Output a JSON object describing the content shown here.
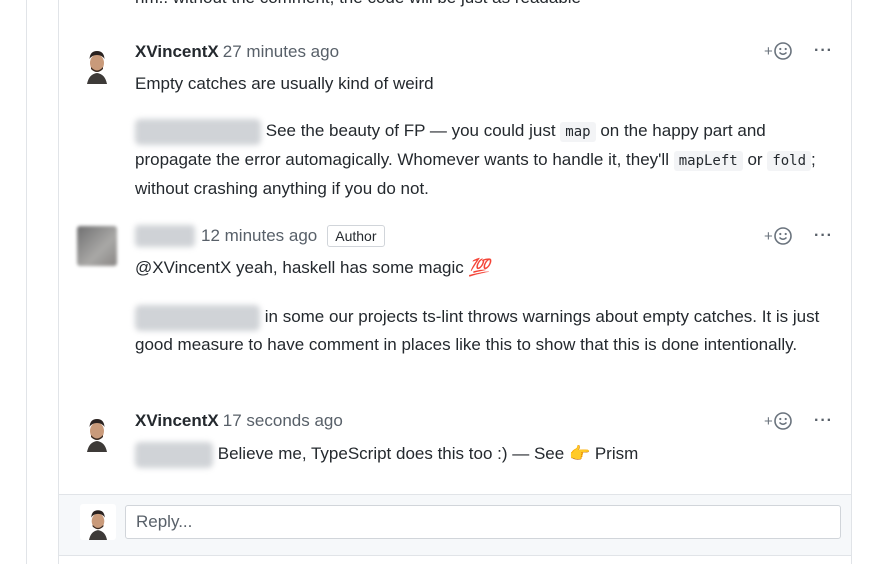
{
  "top_cutoff_text": "hm.. without the comment, the code will be just as readable",
  "comments": [
    {
      "author": "XVincentX",
      "time": "27 minutes ago",
      "paragraphs": [
        "Empty catches are usually kind of weird"
      ],
      "quote_part1": "See the beauty of FP — you could just",
      "code1": "map",
      "quote_part2": "on the happy part and propagate the error automagically. Whomever wants to handle it, they'll",
      "code2": "mapLeft",
      "quote_part3": "or",
      "code3": "fold",
      "quote_part4": "; without crashing anything if you do not."
    },
    {
      "time": "12 minutes ago",
      "badge": "Author",
      "line1": "@XVincentX yeah, haskell has some magic",
      "emoji": "💯",
      "line2": "in some our projects ts-lint throws warnings about empty catches. It is just good measure to have comment in places like this to show that this is done intentionally."
    },
    {
      "author": "XVincentX",
      "time": "17 seconds ago",
      "text": "Believe me, TypeScript does this too :) — See",
      "emoji": "👉",
      "link": "Prism"
    }
  ],
  "reactions": {
    "plus": "+",
    "smiley": "☺",
    "more": "···"
  },
  "reply": {
    "placeholder": "Reply..."
  }
}
